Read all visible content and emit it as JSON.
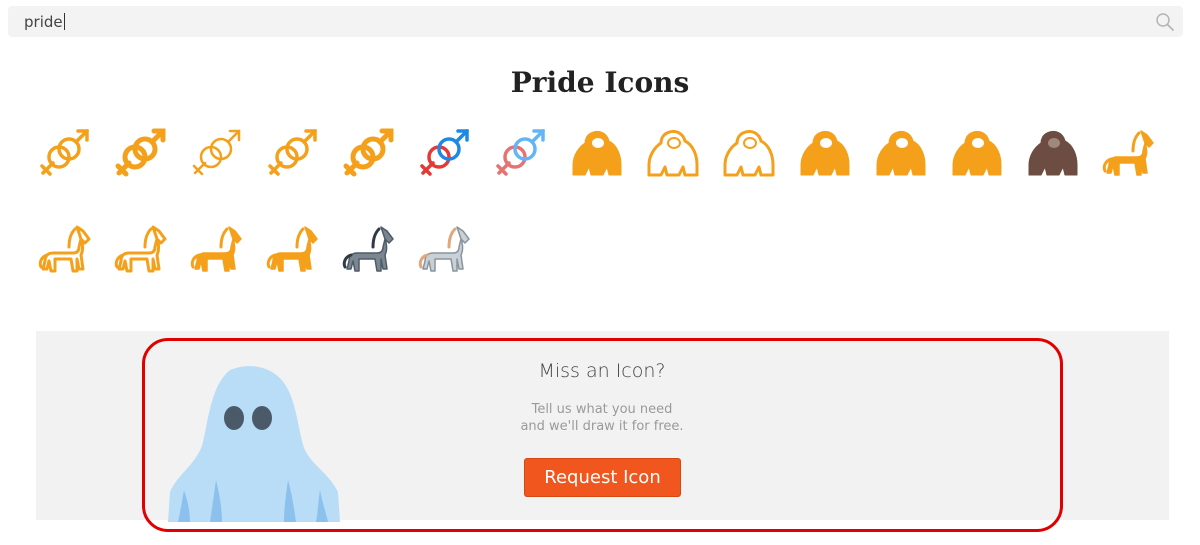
{
  "search": {
    "value": "pride"
  },
  "page": {
    "title": "Pride Icons"
  },
  "icons": [
    {
      "name": "gender-symbols-outline-icon",
      "kind": "gender",
      "style": "outline",
      "color": "#f5a01a"
    },
    {
      "name": "gender-symbols-bold-icon",
      "kind": "gender",
      "style": "bold",
      "color": "#f5a01a"
    },
    {
      "name": "gender-symbols-thin-icon",
      "kind": "gender",
      "style": "thin",
      "color": "#f5a01a"
    },
    {
      "name": "gender-symbols-medium-icon",
      "kind": "gender",
      "style": "medium",
      "color": "#f5a01a"
    },
    {
      "name": "gender-symbols-filled-icon",
      "kind": "gender",
      "style": "filled",
      "color": "#f5a01a"
    },
    {
      "name": "gender-symbols-color-icon",
      "kind": "gender",
      "style": "color",
      "color": "#e53935"
    },
    {
      "name": "gender-symbols-color-outline-icon",
      "kind": "gender",
      "style": "color-outline",
      "color": "#e57373"
    },
    {
      "name": "gorilla-filled-icon",
      "kind": "gorilla",
      "style": "filled",
      "color": "#f5a01a"
    },
    {
      "name": "gorilla-outline-icon",
      "kind": "gorilla",
      "style": "outline",
      "color": "#f5a01a"
    },
    {
      "name": "gorilla-head-outline-icon",
      "kind": "gorilla",
      "style": "thin",
      "color": "#f5a01a"
    },
    {
      "name": "gorilla-solid-icon",
      "kind": "gorilla",
      "style": "filled",
      "color": "#f5a01a"
    },
    {
      "name": "gorilla-walking-icon",
      "kind": "gorilla",
      "style": "filled",
      "color": "#f5a01a"
    },
    {
      "name": "gorilla-sitting-icon",
      "kind": "gorilla",
      "style": "filled",
      "color": "#f5a01a"
    },
    {
      "name": "gorilla-color-icon",
      "kind": "gorilla",
      "style": "color",
      "color": "#6d4c41"
    },
    {
      "name": "horse-filled-icon",
      "kind": "horse",
      "style": "filled",
      "color": "#f5a01a"
    },
    {
      "name": "horse-outline-icon",
      "kind": "horse",
      "style": "outline",
      "color": "#f5a01a"
    },
    {
      "name": "horse-thin-icon",
      "kind": "horse",
      "style": "thin",
      "color": "#f5a01a"
    },
    {
      "name": "horse-solid-icon",
      "kind": "horse",
      "style": "filled",
      "color": "#f5a01a"
    },
    {
      "name": "horse-standing-icon",
      "kind": "horse",
      "style": "filled",
      "color": "#f5a01a"
    },
    {
      "name": "horse-grey-color-icon",
      "kind": "horse",
      "style": "color",
      "color": "#7a8792"
    },
    {
      "name": "horse-white-color-icon",
      "kind": "horse",
      "style": "color-light",
      "color": "#c9d0d6"
    }
  ],
  "banner": {
    "title": "Miss an Icon?",
    "text_line1": "Tell us what you need",
    "text_line2": "and we'll draw it for free.",
    "button_label": "Request Icon",
    "button_color": "#f0561d",
    "highlight_color": "#e00000"
  }
}
